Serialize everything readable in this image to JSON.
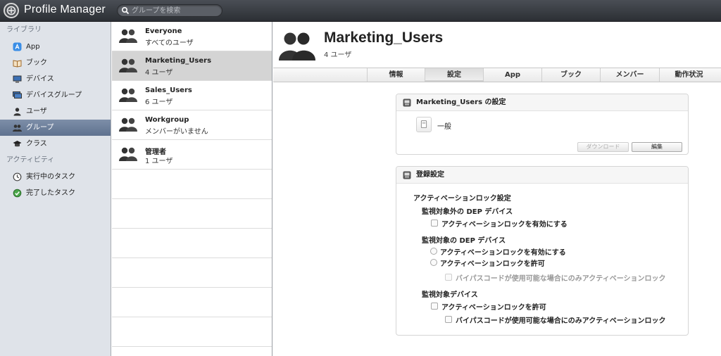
{
  "app": {
    "title": "Profile Manager",
    "search_placeholder": "グループを検索"
  },
  "sidebar": {
    "library_header": "ライブラリ",
    "items": [
      {
        "label": "App",
        "icon": "app-store-icon"
      },
      {
        "label": "ブック",
        "icon": "book-icon"
      },
      {
        "label": "デバイス",
        "icon": "device-icon"
      },
      {
        "label": "デバイスグループ",
        "icon": "device-group-icon"
      },
      {
        "label": "ユーザ",
        "icon": "user-icon"
      },
      {
        "label": "グループ",
        "icon": "group-icon",
        "selected": true
      },
      {
        "label": "クラス",
        "icon": "class-icon"
      }
    ],
    "activity_header": "アクティビティ",
    "activity_items": [
      {
        "label": "実行中のタスク",
        "icon": "clock-icon"
      },
      {
        "label": "完了したタスク",
        "icon": "completed-icon"
      }
    ]
  },
  "groups": [
    {
      "name": "Everyone",
      "sub": "すべてのユーザ"
    },
    {
      "name": "Marketing_Users",
      "sub": "4 ユーザ",
      "selected": true
    },
    {
      "name": "Sales_Users",
      "sub": "6 ユーザ"
    },
    {
      "name": "Workgroup",
      "sub": "メンバーがいません"
    },
    {
      "name": "管理者",
      "sub": "1 ユーザ"
    }
  ],
  "detail": {
    "title": "Marketing_Users",
    "subtitle": "4 ユーザ",
    "tabs": [
      "情報",
      "設定",
      "App",
      "ブック",
      "メンバー",
      "動作状況"
    ],
    "active_tab": "設定",
    "settings_panel": {
      "title": "Marketing_Users の設定",
      "general_label": "一般",
      "download_label": "ダウンロード",
      "edit_label": "編集"
    },
    "enrollment_panel": {
      "title": "登録設定",
      "activation_lock_title": "アクティベーションロック設定",
      "unsupervised_dep_title": "監視対象外の DEP デバイス",
      "unsupervised_enable": "アクティベーションロックを有効にする",
      "supervised_dep_title": "監視対象の DEP デバイス",
      "supervised_enable": "アクティベーションロックを有効にする",
      "supervised_allow": "アクティベーションロックを許可",
      "supervised_bypass": "バイパスコードが使用可能な場合にのみアクティベーションロック",
      "supervised_devices_title": "監視対象デバイス",
      "devices_allow": "アクティベーションロックを許可",
      "devices_bypass": "バイパスコードが使用可能な場合にのみアクティベーションロック"
    }
  }
}
